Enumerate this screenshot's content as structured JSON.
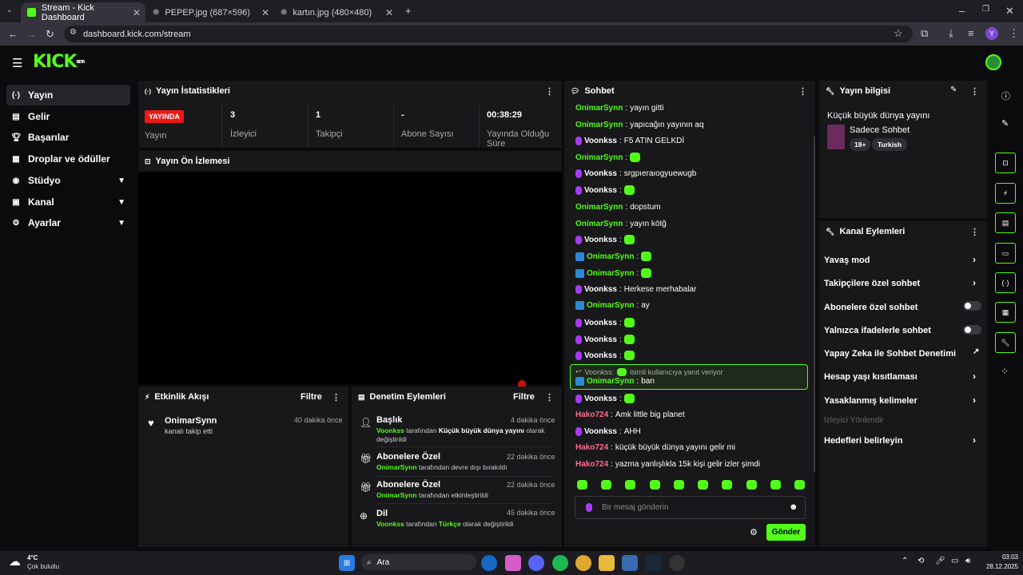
{
  "browser": {
    "tabs": [
      {
        "title": "Stream - Kick Dashboard"
      },
      {
        "title": "PEPEP.jpg (687×596)"
      },
      {
        "title": "kartın.jpg (480×480)"
      }
    ],
    "url": "dashboard.kick.com/stream",
    "profile_letter": "Y"
  },
  "kick": {
    "logo": "KICK",
    "beta": "BETA"
  },
  "sidebar": {
    "items": [
      {
        "label": "Yayın"
      },
      {
        "label": "Gelir"
      },
      {
        "label": "Başarılar"
      },
      {
        "label": "Droplar ve ödüller"
      },
      {
        "label": "Stüdyo"
      },
      {
        "label": "Kanal"
      },
      {
        "label": "Ayarlar"
      }
    ]
  },
  "stats": {
    "title": "Yayın İstatistikleri",
    "live_badge": "YAYINDA",
    "live_label": "Yayın",
    "viewers_value": "3",
    "viewers_label": "İzleyici",
    "followers_value": "1",
    "followers_label": "Takipçi",
    "subs_value": "-",
    "subs_label": "Abone Sayısı",
    "duration_value": "00:38:29",
    "duration_label_1": "Yayında Olduğu",
    "duration_label_2": "Süre"
  },
  "preview": {
    "title": "Yayın Ön İzlemesi"
  },
  "activity": {
    "title": "Etkinlik Akışı",
    "filter": "Filtre",
    "items": [
      {
        "user": "OnimarSynn",
        "text": "kanalı takip etti",
        "time": "40 dakika önce"
      }
    ]
  },
  "moderation": {
    "title": "Denetim Eylemleri",
    "filter": "Filtre",
    "items": [
      {
        "title": "Başlık",
        "time": "4 dakika önce",
        "user": "Voonkss",
        "mid": " tarafından ",
        "bold": "Küçük büyük dünya yayını",
        "rest": " olarak",
        "line2": "değiştirildi"
      },
      {
        "title": "Abonelere Özel",
        "time": "22 dakika önce",
        "user": "OnimarSynn",
        "mid": " tarafından devre dışı bırakıldı"
      },
      {
        "title": "Abonelere Özel",
        "time": "22 dakika önce",
        "user": "OnimarSynn",
        "mid": " tarafından etkinleştirildi"
      },
      {
        "title": "Dil",
        "time": "45 dakika önce",
        "user": "Voonkss",
        "mid": " tarafından ",
        "bold": "Türkçe",
        "rest": " olarak değiştirildi"
      }
    ]
  },
  "chat": {
    "title": "Sohbet",
    "messages": [
      {
        "user": "OnimarSynn",
        "text": "yayın gitti"
      },
      {
        "user": "OnimarSynn",
        "text": "yapıcağın yayının aq"
      },
      {
        "user": "Voonkss",
        "text": "F5 ATIN GELKDİ"
      },
      {
        "user": "OnimarSynn",
        "text": ""
      },
      {
        "user": "Voonkss",
        "text": "srgpıeraıogyuewugb"
      },
      {
        "user": "Voonkss",
        "text": ""
      },
      {
        "user": "OnimarSynn",
        "text": "dopstum"
      },
      {
        "user": "OnimarSynn",
        "text": "yayın kötğ"
      },
      {
        "user": "Voonkss",
        "text": ""
      },
      {
        "user": "OnimarSynn",
        "text": ""
      },
      {
        "user": "OnimarSynn",
        "text": ""
      },
      {
        "user": "Voonkss",
        "text": "Herkese merhabalar"
      },
      {
        "user": "OnimarSynn",
        "text": "ay"
      },
      {
        "user": "Voonkss",
        "text": ""
      },
      {
        "user": "Voonkss",
        "text": ""
      },
      {
        "user": "Voonkss",
        "text": ""
      }
    ],
    "reply": {
      "to_user": "Voonkss:",
      "hint": "isimli kullanıcıya yanıt veriyor",
      "user": "OnimarSynn",
      "text": "ban"
    },
    "messages2": [
      {
        "user": "Voonkss",
        "text": ""
      },
      {
        "user": "Hako724",
        "text": "Amk little big planet"
      },
      {
        "user": "Voonkss",
        "text": "AHH"
      },
      {
        "user": "Hako724",
        "text": "küçük büyük dünya yayını gelir mi"
      },
      {
        "user": "Hako724",
        "text": "yazma yanlışlıkla 15k kişi gelir izler şimdi"
      }
    ],
    "placeholder": "Bir mesaj gönderin",
    "send": "Gönder"
  },
  "stream_info": {
    "title": "Yayın bilgisi",
    "stream_title": "Küçük büyük dünya yayını",
    "category": "Sadece Sohbet",
    "tags": [
      "18+",
      "Turkish"
    ]
  },
  "channel_actions": {
    "title": "Kanal Eylemleri",
    "items": [
      {
        "label": "Yavaş mod",
        "control": "arrow"
      },
      {
        "label": "Takipçilere özel sohbet",
        "control": "arrow"
      },
      {
        "label": "Abonelere özel sohbet",
        "control": "toggle",
        "on": false
      },
      {
        "label": "Yalnızca ifadelerle sohbet",
        "control": "toggle",
        "on": false
      },
      {
        "label": "Yapay Zeka ile Sohbet Denetimi",
        "control": "external"
      },
      {
        "label": "Hesap yaşı kısıtlaması",
        "control": "arrow"
      },
      {
        "label": "Yasaklanmış kelimeler",
        "control": "arrow"
      },
      {
        "label": "İzleyici Yönlendir",
        "control": "disabled"
      },
      {
        "label": "Hedefleri belirleyin",
        "control": "arrow"
      }
    ]
  },
  "taskbar": {
    "weather_temp": "4°C",
    "weather_text": "Çok bulutlu",
    "search": "Ara",
    "time": "03:03",
    "date": "28.12.2025"
  },
  "colors": {
    "accent": "#53fc18",
    "live": "#e91916",
    "panel": "#18181b"
  }
}
